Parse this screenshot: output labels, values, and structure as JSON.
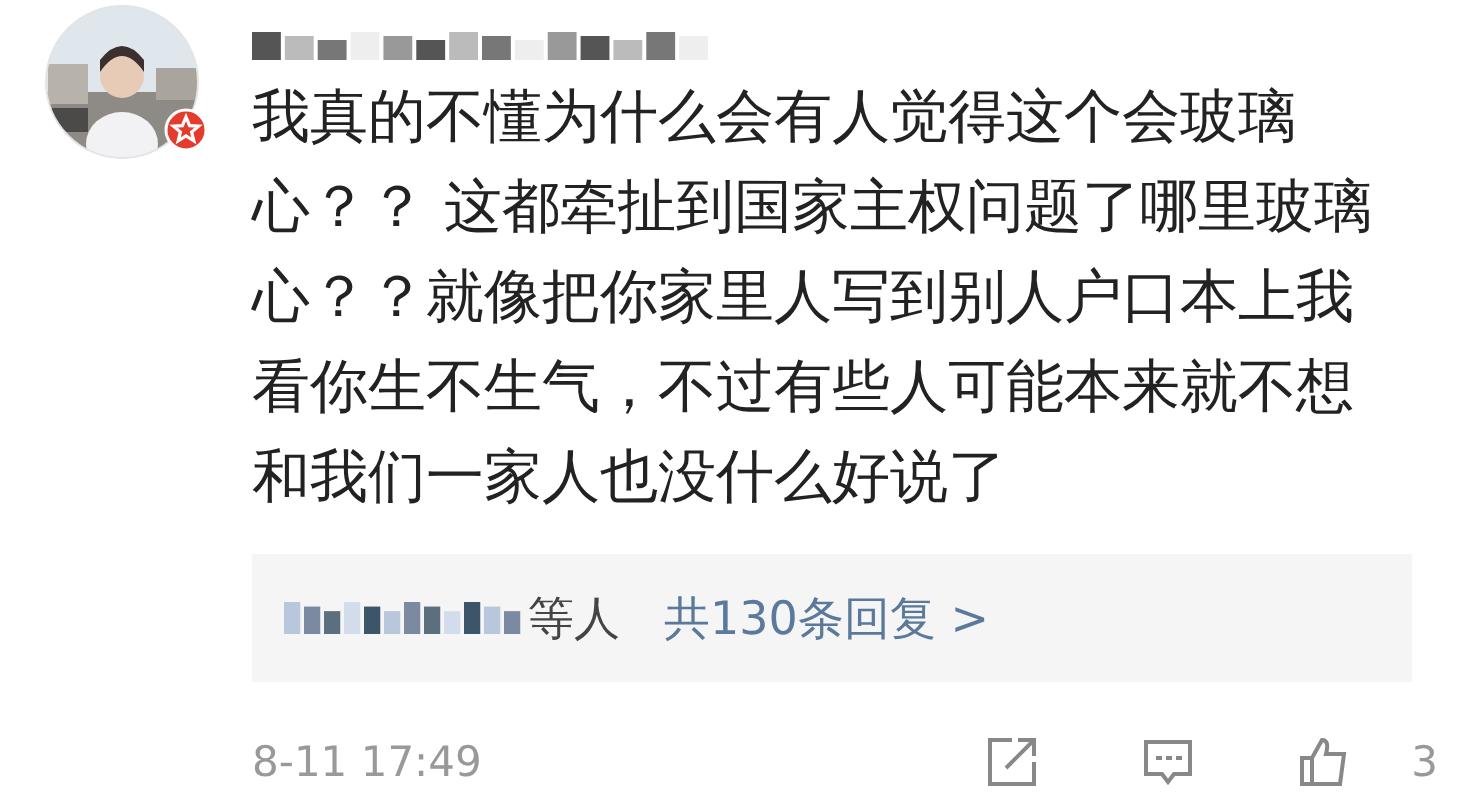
{
  "comment": {
    "avatar": {
      "kind": "picture",
      "verified": true
    },
    "text": "我真的不懂为什么会有人觉得这个会玻璃心？？ 这都牵扯到国家主权问题了哪里玻璃心？？就像把你家里人写到别人户口本上我看你生不生气，不过有些人可能本来就不想和我们一家人也没什么好说了",
    "replies": {
      "people_suffix": "等人",
      "count_link": "共130条回复 >"
    },
    "time": "8-11 17:49",
    "like_count": "3"
  }
}
